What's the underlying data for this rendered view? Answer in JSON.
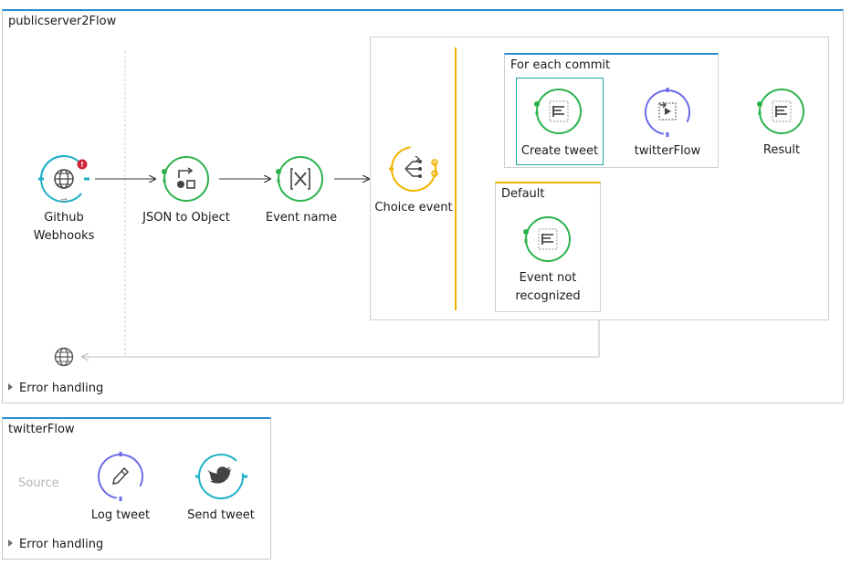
{
  "flows": {
    "main": {
      "title": "publicserver2Flow",
      "error_handling": "Error handling",
      "nodes": {
        "github": "Github\nWebhooks",
        "json_to_object": "JSON to Object",
        "event_name": "Event name",
        "choice_event": "Choice event",
        "create_tweet": "Create tweet",
        "twitter_flow_ref": "twitterFlow",
        "result": "Result",
        "event_not_recognized": "Event not\nrecognized"
      },
      "scopes": {
        "for_each": "For each commit",
        "default": "Default"
      }
    },
    "twitter": {
      "title": "twitterFlow",
      "source_placeholder": "Source",
      "error_handling": "Error handling",
      "nodes": {
        "log_tweet": "Log tweet",
        "send_tweet": "Send tweet"
      }
    }
  },
  "colors": {
    "flow_border_top": "#2a8dd4",
    "transformer_green": "#2bb24c",
    "connector_cyan": "#1fb1c8",
    "router_yellow": "#f0b400",
    "reference_purple": "#6b6be8",
    "error_red": "#d0243a"
  },
  "icons": {
    "github": "globe-icon",
    "json_to_object": "transform-icon",
    "event_name": "set-variable-icon",
    "choice_event": "choice-router-icon",
    "create_tweet": "transform-message-icon",
    "twitter_flow_ref": "flow-reference-icon",
    "result": "transform-message-icon",
    "event_not_recognized": "transform-message-icon",
    "log_tweet": "pencil-icon",
    "send_tweet": "twitter-bird-icon",
    "response": "globe-icon"
  }
}
